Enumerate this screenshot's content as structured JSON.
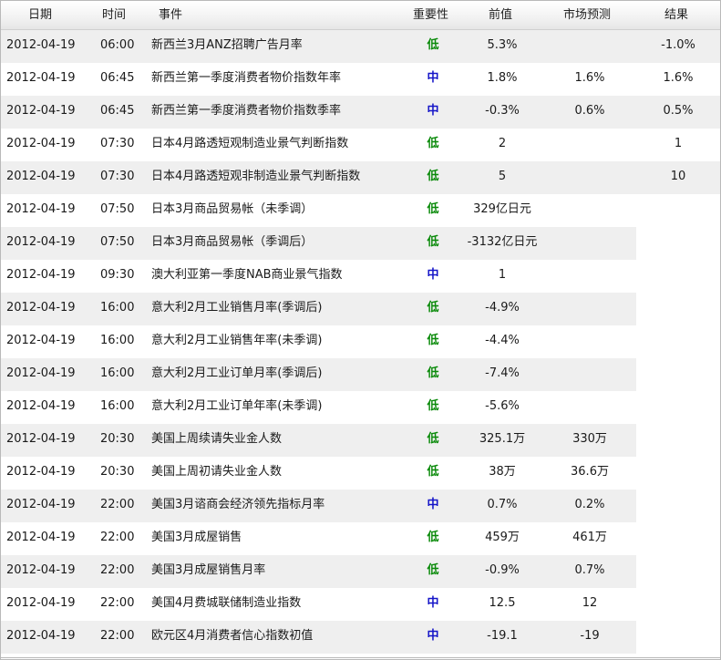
{
  "header": {
    "date": "日期",
    "time": "时间",
    "event": "事件",
    "importance": "重要性",
    "previous": "前值",
    "forecast": "市场预测",
    "result": "结果"
  },
  "colors": {
    "low": "#0a8a0a",
    "medium": "#1515c8",
    "row_alt": "#efefef"
  },
  "rows": [
    {
      "date": "2012-04-19",
      "time": "06:00",
      "event": "新西兰3月ANZ招聘广告月率",
      "importance": "低",
      "level": "low",
      "previous": "5.3%",
      "forecast": "",
      "result": "-1.0%"
    },
    {
      "date": "2012-04-19",
      "time": "06:45",
      "event": "新西兰第一季度消费者物价指数年率",
      "importance": "中",
      "level": "mid",
      "previous": "1.8%",
      "forecast": "1.6%",
      "result": "1.6%"
    },
    {
      "date": "2012-04-19",
      "time": "06:45",
      "event": "新西兰第一季度消费者物价指数季率",
      "importance": "中",
      "level": "mid",
      "previous": "-0.3%",
      "forecast": "0.6%",
      "result": "0.5%"
    },
    {
      "date": "2012-04-19",
      "time": "07:30",
      "event": "日本4月路透短观制造业景气判断指数",
      "importance": "低",
      "level": "low",
      "previous": "2",
      "forecast": "",
      "result": "1"
    },
    {
      "date": "2012-04-19",
      "time": "07:30",
      "event": "日本4月路透短观非制造业景气判断指数",
      "importance": "低",
      "level": "low",
      "previous": "5",
      "forecast": "",
      "result": "10"
    },
    {
      "date": "2012-04-19",
      "time": "07:50",
      "event": "日本3月商品贸易帐（未季调）",
      "importance": "低",
      "level": "low",
      "previous": "329亿日元",
      "forecast": "",
      "result": ""
    },
    {
      "date": "2012-04-19",
      "time": "07:50",
      "event": "日本3月商品贸易帐（季调后）",
      "importance": "低",
      "level": "low",
      "previous": "-3132亿日元",
      "forecast": "",
      "result": ""
    },
    {
      "date": "2012-04-19",
      "time": "09:30",
      "event": "澳大利亚第一季度NAB商业景气指数",
      "importance": "中",
      "level": "mid",
      "previous": "1",
      "forecast": "",
      "result": ""
    },
    {
      "date": "2012-04-19",
      "time": "16:00",
      "event": "意大利2月工业销售月率(季调后)",
      "importance": "低",
      "level": "low",
      "previous": "-4.9%",
      "forecast": "",
      "result": ""
    },
    {
      "date": "2012-04-19",
      "time": "16:00",
      "event": "意大利2月工业销售年率(未季调)",
      "importance": "低",
      "level": "low",
      "previous": "-4.4%",
      "forecast": "",
      "result": ""
    },
    {
      "date": "2012-04-19",
      "time": "16:00",
      "event": "意大利2月工业订单月率(季调后)",
      "importance": "低",
      "level": "low",
      "previous": "-7.4%",
      "forecast": "",
      "result": ""
    },
    {
      "date": "2012-04-19",
      "time": "16:00",
      "event": "意大利2月工业订单年率(未季调)",
      "importance": "低",
      "level": "low",
      "previous": "-5.6%",
      "forecast": "",
      "result": ""
    },
    {
      "date": "2012-04-19",
      "time": "20:30",
      "event": "美国上周续请失业金人数",
      "importance": "低",
      "level": "low",
      "previous": "325.1万",
      "forecast": "330万",
      "result": ""
    },
    {
      "date": "2012-04-19",
      "time": "20:30",
      "event": "美国上周初请失业金人数",
      "importance": "低",
      "level": "low",
      "previous": "38万",
      "forecast": "36.6万",
      "result": ""
    },
    {
      "date": "2012-04-19",
      "time": "22:00",
      "event": "美国3月谘商会经济领先指标月率",
      "importance": "中",
      "level": "mid",
      "previous": "0.7%",
      "forecast": "0.2%",
      "result": ""
    },
    {
      "date": "2012-04-19",
      "time": "22:00",
      "event": "美国3月成屋销售",
      "importance": "低",
      "level": "low",
      "previous": "459万",
      "forecast": "461万",
      "result": ""
    },
    {
      "date": "2012-04-19",
      "time": "22:00",
      "event": "美国3月成屋销售月率",
      "importance": "低",
      "level": "low",
      "previous": "-0.9%",
      "forecast": "0.7%",
      "result": ""
    },
    {
      "date": "2012-04-19",
      "time": "22:00",
      "event": "美国4月费城联储制造业指数",
      "importance": "中",
      "level": "mid",
      "previous": "12.5",
      "forecast": "12",
      "result": ""
    },
    {
      "date": "2012-04-19",
      "time": "22:00",
      "event": "欧元区4月消费者信心指数初值",
      "importance": "中",
      "level": "mid",
      "previous": "-19.1",
      "forecast": "-19",
      "result": ""
    }
  ]
}
